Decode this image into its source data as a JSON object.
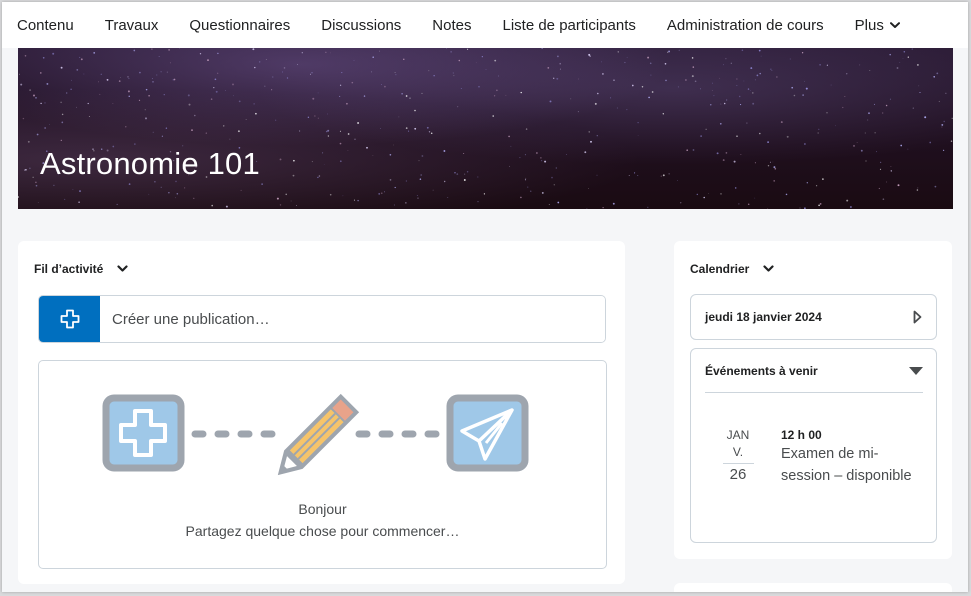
{
  "nav": {
    "items": [
      {
        "label": "Contenu"
      },
      {
        "label": "Travaux"
      },
      {
        "label": "Questionnaires"
      },
      {
        "label": "Discussions"
      },
      {
        "label": "Notes"
      },
      {
        "label": "Liste de participants"
      },
      {
        "label": "Administration de cours"
      },
      {
        "label": "Plus",
        "icon": "chevron-down-icon"
      }
    ]
  },
  "banner": {
    "title": "Astronomie 101"
  },
  "activity": {
    "heading": "Fil d’activité",
    "post_placeholder": "Créer une publication…",
    "add_icon": "plus-icon",
    "illustration_icons": [
      "plus-icon",
      "pencil-icon",
      "paper-plane-icon"
    ],
    "empty_title": "Bonjour",
    "empty_subtitle": "Partagez quelque chose pour commencer…"
  },
  "calendar": {
    "heading": "Calendrier",
    "current_date": "jeudi 18 janvier 2024",
    "next_icon": "play-triangle-icon",
    "events_heading": "Événements à venir",
    "events": [
      {
        "month": "JAN",
        "weekday": "V.",
        "day": "26",
        "time": "12 h 00",
        "title": "Examen de mi-session – disponible"
      }
    ]
  },
  "colors": {
    "accent": "#006fbf",
    "background": "#f5f6f8",
    "border": "#cdd5dc"
  }
}
